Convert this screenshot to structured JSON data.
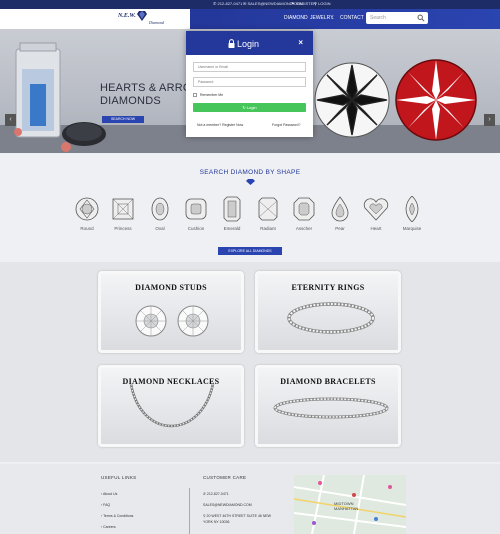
{
  "topbar": {
    "phone": "212-827-0471",
    "email": "SALES@NEWDIAMOND.COM",
    "register": "REGISTER",
    "login": "LOGIN"
  },
  "logo": {
    "name": "N.E.W.",
    "sub": "Diamond"
  },
  "nav": {
    "items": [
      "DIAMOND",
      "JEWELRY",
      "CONTACT"
    ],
    "search_placeholder": "Search"
  },
  "hero": {
    "headline_1": "HEARTS & ARROWS",
    "headline_2": "DIAMONDS",
    "button": "SEARCH NOW",
    "prev": "‹",
    "next": "›"
  },
  "modal": {
    "title": "Login",
    "close": "×",
    "username_placeholder": "Username or Email",
    "password_placeholder": "Password",
    "remember": "Remember Me",
    "login_button": "Login",
    "register_link": "Not a member? Register Now",
    "forgot_link": "Forgot Password?"
  },
  "shapes": {
    "title": "SEARCH DIAMOND BY SHAPE",
    "items": [
      "Round",
      "Princess",
      "Oval",
      "Cushion",
      "Emerald",
      "Radiant",
      "Asscher",
      "Pear",
      "Heart",
      "Marquise"
    ],
    "button": "EXPLORE ALL DIAMONDS"
  },
  "categories": [
    "DIAMOND STUDS",
    "ETERNITY RINGS",
    "DIAMOND NECKLACES",
    "DIAMOND BRACELETS"
  ],
  "footer": {
    "useful_title": "USEFUL LINKS",
    "useful_links": [
      "About Us",
      "FAQ",
      "Terms & Conditions",
      "Careers"
    ],
    "care_title": "CUSTOMER CARE",
    "phone": "212-827-0471",
    "email": "SALES@NEWDIAMOND.COM",
    "address_1": "20 WEST 46TH STREET SUITE 46 NEW",
    "address_2": "YORK NY 10036",
    "map_labels": [
      "MIDTOWN",
      "MANHATTAN"
    ]
  },
  "colors": {
    "brand": "#24379a",
    "button": "#2a44b0",
    "login": "#46c65a"
  }
}
